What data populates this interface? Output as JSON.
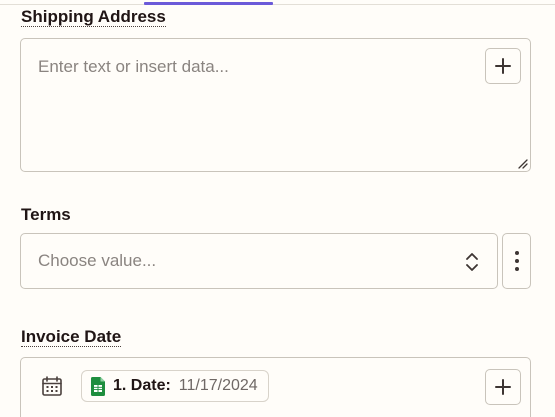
{
  "shipping_address": {
    "label": "Shipping Address",
    "placeholder": "Enter text or insert data...",
    "insert_icon": "plus-icon",
    "resize_icon": "resize-grip-icon"
  },
  "terms": {
    "label": "Terms",
    "placeholder": "Choose value...",
    "select_icon": "chevron-up-down-icon",
    "more_icon": "kebab-menu-icon"
  },
  "invoice_date": {
    "label": "Invoice Date",
    "calendar_icon": "calendar-icon",
    "pill": {
      "source_icon": "google-sheets-icon",
      "key": "1. Date:",
      "value": "11/17/2024",
      "icon_color": "#1e8e3e"
    },
    "insert_icon": "plus-icon"
  },
  "colors": {
    "accent": "#6b5ad9",
    "border": "#c9c4bb",
    "background": "#fffdf9"
  }
}
